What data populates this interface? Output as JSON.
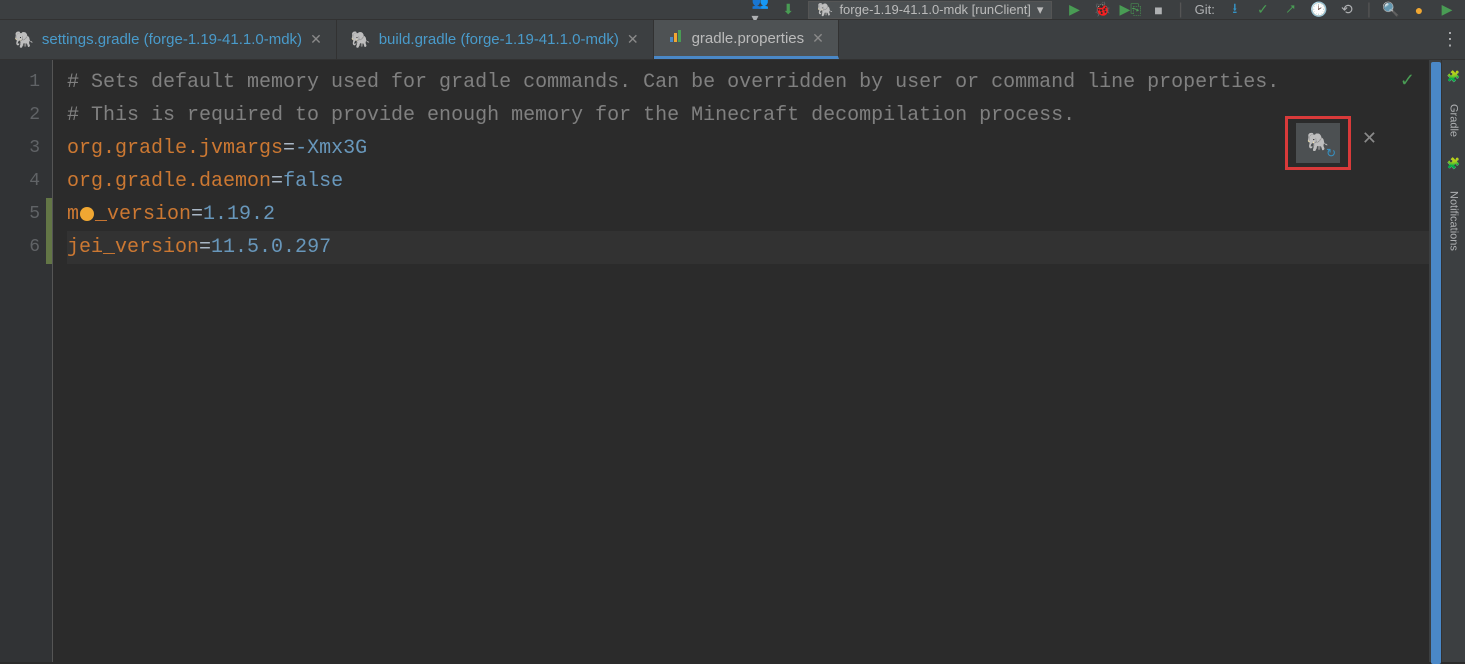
{
  "toolbar": {
    "run_config": "forge-1.19-41.1.0-mdk [runClient]",
    "git_label": "Git:"
  },
  "tabs": [
    {
      "label": "settings.gradle (forge-1.19-41.1.0-mdk)",
      "active": false,
      "icon": "elephant"
    },
    {
      "label": "build.gradle (forge-1.19-41.1.0-mdk)",
      "active": false,
      "icon": "elephant"
    },
    {
      "label": "gradle.properties",
      "active": true,
      "icon": "bars"
    }
  ],
  "editor": {
    "lines": [
      {
        "n": "1",
        "type": "comment",
        "text": "# Sets default memory used for gradle commands. Can be overridden by user or command line properties."
      },
      {
        "n": "2",
        "type": "comment",
        "text": "# This is required to provide enough memory for the Minecraft decompilation process."
      },
      {
        "n": "3",
        "type": "kv",
        "key": "org.gradle.jvmargs",
        "eq": "=",
        "val": "-Xmx3G"
      },
      {
        "n": "4",
        "type": "kv",
        "key": "org.gradle.daemon",
        "eq": "=",
        "val": "false"
      },
      {
        "n": "5",
        "type": "kv_bulb",
        "key_pre": "m",
        "key_post": "_version",
        "eq": "=",
        "val": "1.19.2"
      },
      {
        "n": "6",
        "type": "kv",
        "key": "jei_version",
        "eq": "=",
        "val": "11.5.0.297",
        "current": true
      }
    ]
  },
  "sidepanels": {
    "gradle": "Gradle",
    "notifications": "Notifications"
  }
}
